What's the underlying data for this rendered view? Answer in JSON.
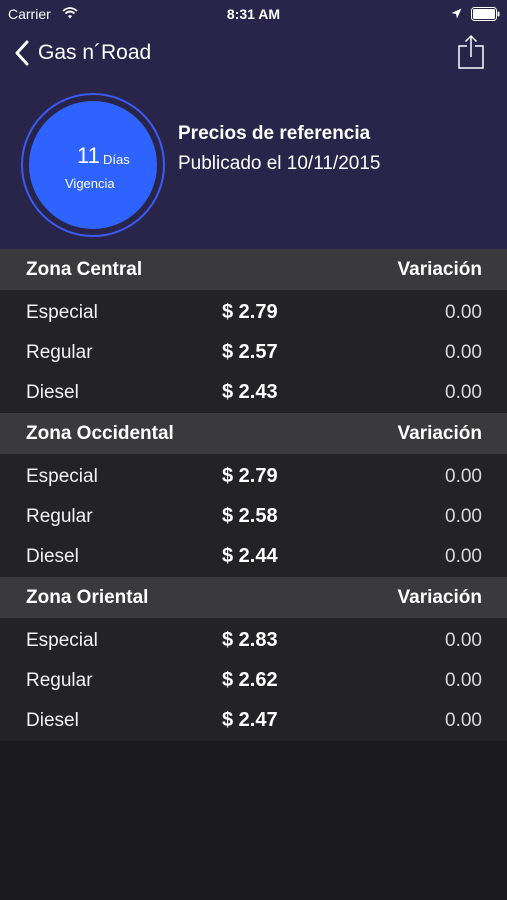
{
  "status_bar": {
    "carrier": "Carrier",
    "time": "8:31 AM"
  },
  "nav": {
    "back_label": "Gas n´Road"
  },
  "validity": {
    "days_number": "11",
    "days_label": "Días",
    "label": "Vigencia"
  },
  "reference": {
    "title": "Precios de referencia",
    "published": "Publicado el 10/11/2015"
  },
  "zones": [
    {
      "name": "Zona Central",
      "variation_label": "Variación",
      "rows": [
        {
          "fuel": "Especial",
          "price": "$ 2.79",
          "variation": "0.00"
        },
        {
          "fuel": "Regular",
          "price": "$ 2.57",
          "variation": "0.00"
        },
        {
          "fuel": "Diesel",
          "price": "$ 2.43",
          "variation": "0.00"
        }
      ]
    },
    {
      "name": "Zona Occidental",
      "variation_label": "Variación",
      "rows": [
        {
          "fuel": "Especial",
          "price": "$ 2.79",
          "variation": "0.00"
        },
        {
          "fuel": "Regular",
          "price": "$ 2.58",
          "variation": "0.00"
        },
        {
          "fuel": "Diesel",
          "price": "$ 2.44",
          "variation": "0.00"
        }
      ]
    },
    {
      "name": "Zona Oriental",
      "variation_label": "Variación",
      "rows": [
        {
          "fuel": "Especial",
          "price": "$ 2.83",
          "variation": "0.00"
        },
        {
          "fuel": "Regular",
          "price": "$ 2.62",
          "variation": "0.00"
        },
        {
          "fuel": "Diesel",
          "price": "$ 2.47",
          "variation": "0.00"
        }
      ]
    }
  ],
  "colors": {
    "header_bg": "#28244a",
    "accent": "#2f63ff",
    "zone_header_bg": "#3a3a3c",
    "row_bg": "#232325"
  },
  "icons": [
    "wifi-icon",
    "location-arrow-icon",
    "battery-icon",
    "back-chevron-icon",
    "share-icon"
  ]
}
